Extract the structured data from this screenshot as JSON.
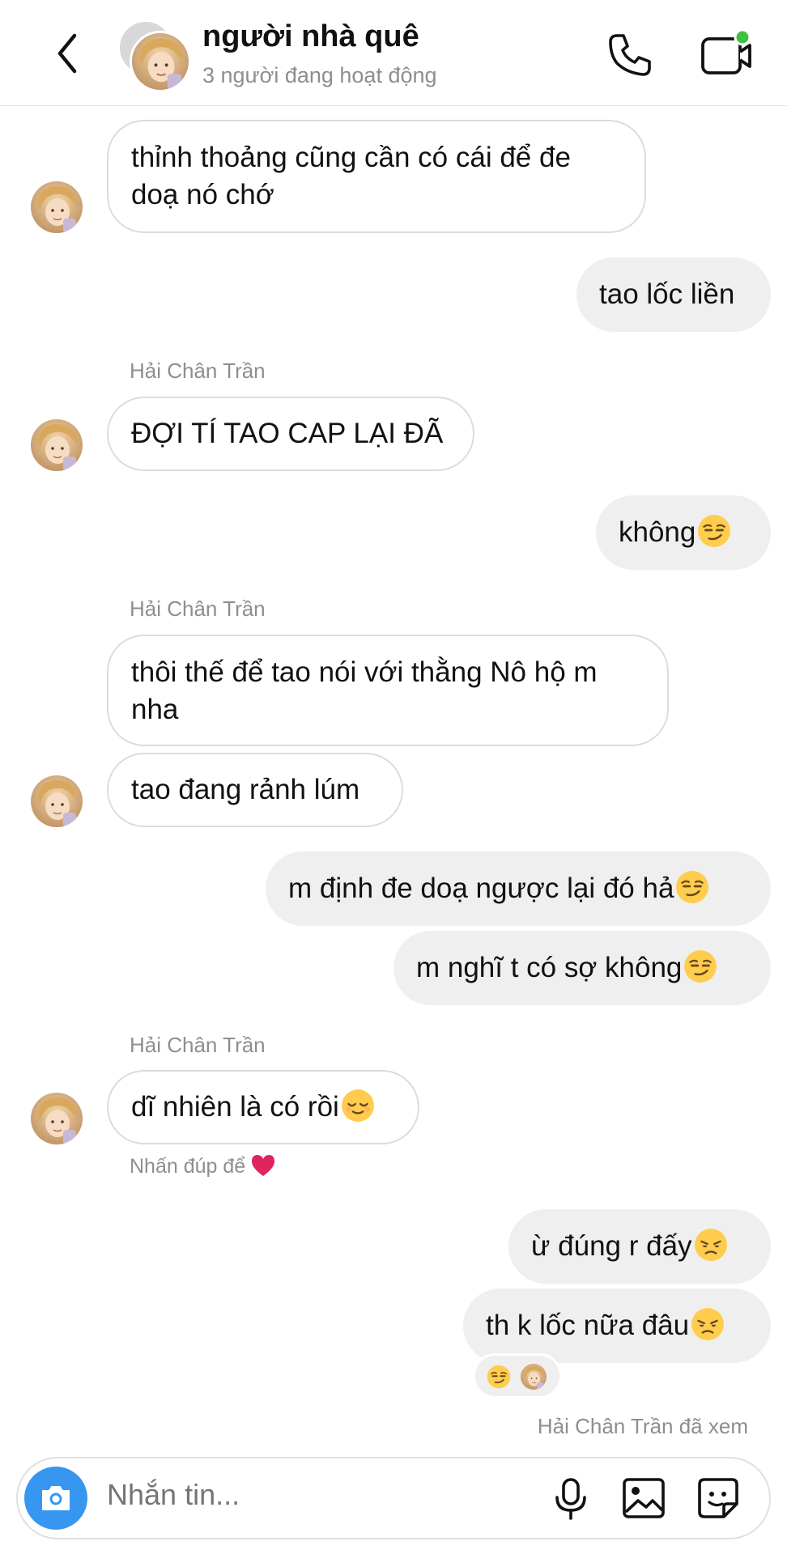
{
  "header": {
    "title": "người nhà quê",
    "subtitle": "3 người đang hoạt động",
    "icons": [
      "back-icon",
      "phone-icon",
      "video-call-icon"
    ],
    "online_color": "#3fc03f"
  },
  "messages": [
    {
      "side": "in",
      "text": "thỉnh thoảng cũng cần có cái để đe doạ nó chớ"
    },
    {
      "side": "out",
      "text": "tao lốc liền"
    },
    {
      "side": "in",
      "sender": "Hải Chân Trần",
      "text": "ĐỢI TÍ TAO CAP LẠI ĐÃ"
    },
    {
      "side": "out",
      "text": "không",
      "emoji": "smirk"
    },
    {
      "side": "in",
      "sender": "Hải Chân Trần",
      "text": "thôi thế để tao nói với thằng Nô hộ m nha"
    },
    {
      "side": "in",
      "text": "tao đang rảnh lúm"
    },
    {
      "side": "out",
      "text": "m định đe doạ ngược lại đó hả",
      "emoji": "smirk"
    },
    {
      "side": "out",
      "text": "m nghĩ t có sợ không",
      "emoji": "smirk"
    },
    {
      "side": "in",
      "sender": "Hải Chân Trần",
      "text": "dĩ nhiên là có rồi",
      "emoji": "relieved"
    },
    {
      "side": "out",
      "text": "ừ đúng r đấy",
      "emoji": "disappointed"
    },
    {
      "side": "out",
      "text": "th k lốc nữa đâu",
      "emoji": "disappointed"
    }
  ],
  "double_tap_hint": "Nhấn đúp để",
  "reaction_emoji": "smirk",
  "seen_text": "Hải Chân Trần đã xem",
  "composer": {
    "placeholder": "Nhắn tin...",
    "icons": [
      "camera-icon",
      "microphone-icon",
      "gallery-icon",
      "sticker-icon"
    ],
    "camera_color": "#3797f0"
  },
  "colors": {
    "incoming_bubble": "#ffffff",
    "outgoing_bubble": "#efefef",
    "secondary_text": "#8e8e8e"
  }
}
